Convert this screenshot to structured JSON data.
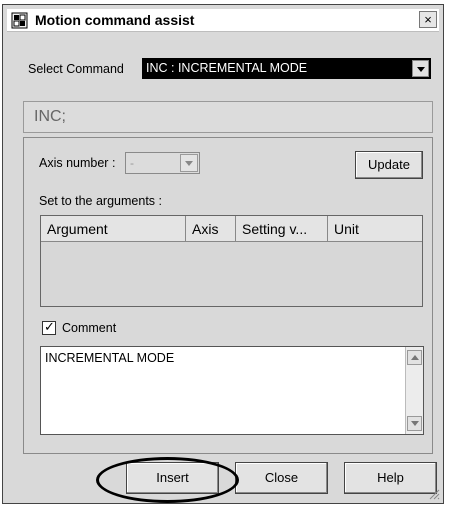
{
  "window": {
    "title": "Motion command assist",
    "close_glyph": "×"
  },
  "select_command": {
    "label": "Select Command",
    "value": "INC : INCREMENTAL MODE"
  },
  "command_text": "INC;",
  "axis": {
    "label": "Axis number :",
    "value": "-"
  },
  "update_label": "Update",
  "arguments": {
    "label": "Set to the arguments :",
    "columns": [
      "Argument",
      "Axis",
      "Setting v...",
      "Unit"
    ]
  },
  "comment": {
    "label": "Comment",
    "checked": true,
    "check_glyph": "✓",
    "text": "INCREMENTAL MODE"
  },
  "buttons": {
    "insert": "Insert",
    "close": "Close",
    "help": "Help"
  },
  "icons": {
    "app": "app-icon",
    "close": "close-icon",
    "dropdown": "chevron-down-icon",
    "scroll_up": "scroll-up-icon",
    "scroll_down": "scroll-down-icon",
    "grip": "resize-grip-icon"
  }
}
